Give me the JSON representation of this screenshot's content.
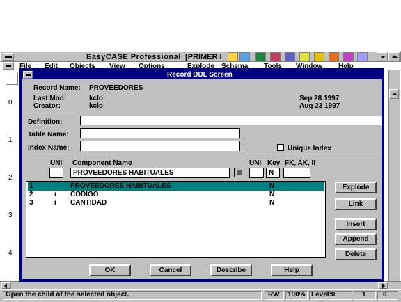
{
  "app": {
    "title": "EasyCASE Professional",
    "doc_title": "[PRIMER I"
  },
  "menu": [
    "File",
    "Edit",
    "Objects",
    "View",
    "Options",
    "Explode",
    "Schema",
    "Tools",
    "Window",
    "Help"
  ],
  "dialog": {
    "title": "Record DDL Screen",
    "record_name_label": "Record Name:",
    "record_name": "PROVEEDORES",
    "last_mod_label": "Last Mod:",
    "last_mod_user": "kclo",
    "last_mod_date": "Sep 28 1997",
    "creator_label": "Creator:",
    "creator_user": "kclo",
    "creator_date": "Aug 23 1997",
    "definition_label": "Definition:",
    "definition_value": "",
    "table_name_label": "Table Name:",
    "table_name_value": "",
    "index_name_label": "Index Name:",
    "index_name_value": "",
    "unique_index_label": "Unique Index",
    "unique_index_checked": false,
    "col_unique": "UNI",
    "col_component": "Component Name",
    "col_unique2": "UNI",
    "col_key": "Key",
    "col_fk": "FK, AK, II",
    "edit_uni": "–",
    "edit_component": "PROVEEDORES HABITUALES",
    "edit_uni2": "",
    "edit_key": "N",
    "edit_fk": "",
    "rows": [
      {
        "num": "1",
        "mark": "–",
        "name": "PROVEEDORES HABITUALES",
        "key": "N",
        "selected": true
      },
      {
        "num": "2",
        "mark": "ı",
        "name": "CODIGO",
        "key": "N",
        "selected": false
      },
      {
        "num": "3",
        "mark": "ı",
        "name": "CANTIDAD",
        "key": "N",
        "selected": false
      }
    ],
    "buttons": {
      "explode": "Explode",
      "link": "Link",
      "insert": "Insert",
      "append": "Append",
      "delete": "Delete",
      "ok": "OK",
      "cancel": "Cancel",
      "describe": "Describe",
      "help": "Help"
    }
  },
  "status": {
    "message": "Open the child of the selected object.",
    "mode": "RW",
    "zoom": "100%",
    "level": "Level:0",
    "page": "1",
    "count": "6"
  },
  "ruler": {
    "marks": [
      "0",
      "1",
      "2",
      "3",
      "4"
    ]
  },
  "colors": {
    "dialog_frame": "#000080",
    "selection": "#008080",
    "face": "#c0c0c0"
  }
}
